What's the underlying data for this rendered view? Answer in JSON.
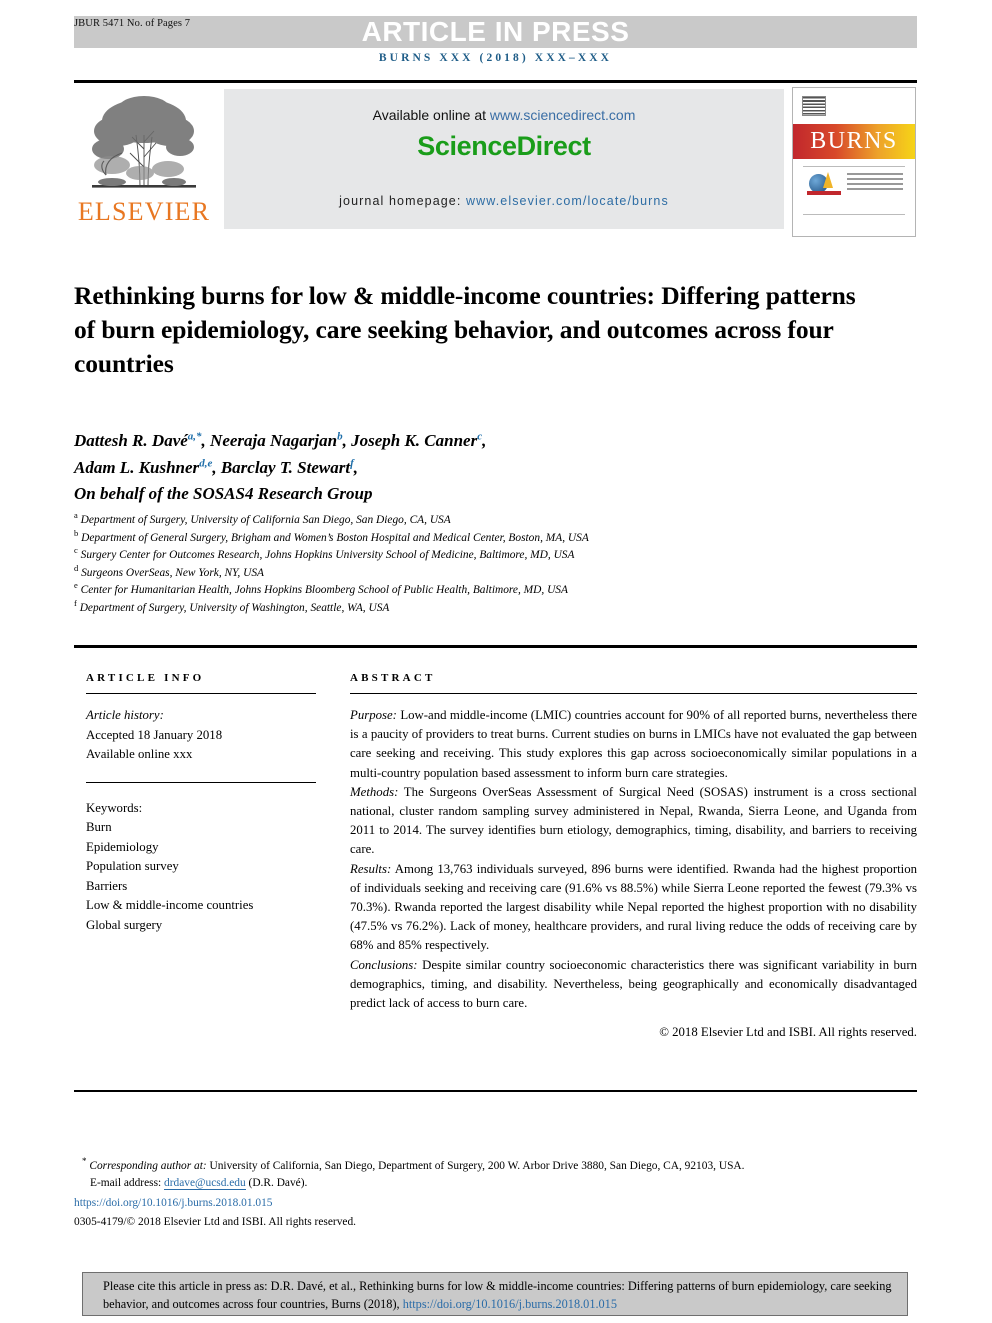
{
  "header": {
    "jbur_id": "JBUR 5471 No. of Pages 7",
    "banner_text": "ARTICLE IN PRESS",
    "journal_ref": "BURNS XXX (2018) XXX–XXX"
  },
  "masthead": {
    "publisher": "ELSEVIER",
    "available_prefix": "Available online at ",
    "available_url": "www.sciencedirect.com",
    "sciencedirect_logo": "ScienceDirect",
    "homepage_label": "journal homepage:",
    "homepage_url": "www.elsevier.com/locate/burns",
    "cover_title": "BURNS"
  },
  "article": {
    "title": "Rethinking burns for low & middle-income countries: Differing patterns of burn epidemiology, care seeking behavior, and outcomes across four countries",
    "authors_line_1": "Dattesh R. Davé a,*, Neeraja Nagarjan b, Joseph K. Canner c,",
    "authors_line_2": "Adam L. Kushner d,e, Barclay T. Stewart f,",
    "authors_line_3": "On behalf of the SOSAS4 Research Group",
    "affiliations": [
      {
        "mark": "a",
        "text": "Department of Surgery, University of California San Diego, San Diego, CA, USA"
      },
      {
        "mark": "b",
        "text": "Department of General Surgery, Brigham and Women’s Boston Hospital and Medical Center, Boston, MA, USA"
      },
      {
        "mark": "c",
        "text": "Surgery Center for Outcomes Research, Johns Hopkins University School of Medicine, Baltimore, MD, USA"
      },
      {
        "mark": "d",
        "text": "Surgeons OverSeas, New York, NY, USA"
      },
      {
        "mark": "e",
        "text": "Center for Humanitarian Health, Johns Hopkins Bloomberg School of Public Health, Baltimore, MD, USA"
      },
      {
        "mark": "f",
        "text": "Department of Surgery, University of Washington, Seattle, WA, USA"
      }
    ]
  },
  "article_info": {
    "heading": "ARTICLE INFO",
    "history_label": "Article history:",
    "history_accepted": "Accepted 18 January 2018",
    "history_online": "Available online xxx",
    "keywords_label": "Keywords:",
    "keywords": [
      "Burn",
      "Epidemiology",
      "Population survey",
      "Barriers",
      "Low & middle-income countries",
      "Global surgery"
    ]
  },
  "abstract": {
    "heading": "ABSTRACT",
    "purpose_label": "Purpose:",
    "purpose_text": " Low-and middle-income (LMIC) countries account for 90% of all reported burns, nevertheless there is a paucity of providers to treat burns. Current studies on burns in LMICs have not evaluated the gap between care seeking and receiving. This study explores this gap across socioeconomically similar populations in a multi-country population based assessment to inform burn care strategies.",
    "methods_label": "Methods:",
    "methods_text": " The Surgeons OverSeas Assessment of Surgical Need (SOSAS) instrument is a cross sectional national, cluster random sampling survey administered in Nepal, Rwanda, Sierra Leone, and Uganda from 2011 to 2014. The survey identifies burn etiology, demographics, timing, disability, and barriers to receiving care.",
    "results_label": "Results:",
    "results_text": " Among 13,763 individuals surveyed, 896 burns were identified. Rwanda had the highest proportion of individuals seeking and receiving care (91.6% vs 88.5%) while Sierra Leone reported the fewest (79.3% vs 70.3%). Rwanda reported the largest disability while Nepal reported the highest proportion with no disability (47.5% vs 76.2%). Lack of money, healthcare providers, and rural living reduce the odds of receiving care by 68% and 85% respectively.",
    "conclusions_label": "Conclusions:",
    "conclusions_text": " Despite similar country socioeconomic characteristics there was significant variability in burn demographics, timing, and disability. Nevertheless, being geographically and economically disadvantaged predict lack of access to burn care.",
    "copyright": "© 2018 Elsevier Ltd and ISBI. All rights reserved."
  },
  "footnotes": {
    "corresponding_label": "Corresponding author at:",
    "corresponding_text": " University of California, San Diego, Department of Surgery, 200 W. Arbor Drive 3880, San Diego, CA, 92103, USA.",
    "email_label": "E-mail address:",
    "email": "drdave@ucsd.edu",
    "email_suffix": " (D.R.  Davé).",
    "doi": "https://doi.org/10.1016/j.burns.2018.01.015",
    "issn_line": "0305-4179/© 2018 Elsevier Ltd and ISBI. All rights reserved."
  },
  "citation_box": {
    "text_before_link": "Please cite this article in press as: D.R. Davé, et al., Rethinking burns for low & middle-income countries: Differing patterns of burn epidemiology, care seeking behavior, and outcomes across four countries, Burns (2018), ",
    "link": "https://doi.org/10.1016/j.burns.2018.01.015"
  },
  "colors": {
    "banner_grey": "#c9c9c9",
    "journal_blue": "#1f5d88",
    "sciencedirect_green": "#1a9d1a",
    "elsevier_orange": "#E87722",
    "link_blue": "#2a6ca8",
    "panel_grey": "#e6e7e8"
  }
}
